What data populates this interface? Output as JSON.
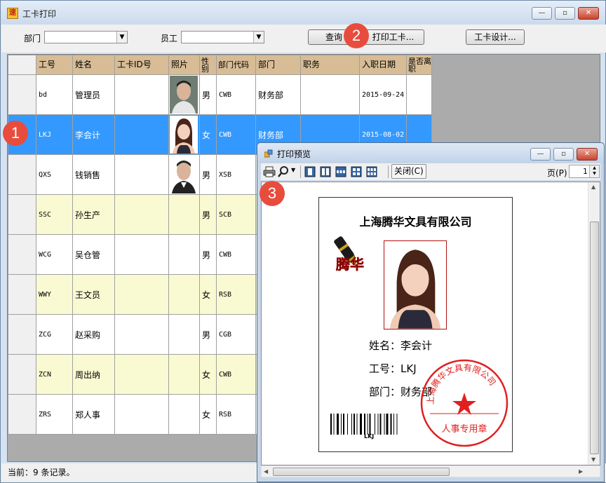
{
  "window": {
    "title": "工卡打印",
    "min_glyph": "—",
    "max_glyph": "▫",
    "close_glyph": "✕"
  },
  "toolbar": {
    "dept_label": "部门",
    "dept_value": "",
    "staff_label": "员工",
    "staff_value": "",
    "query_button": "查询",
    "print_button": "打印工卡...",
    "design_button": "工卡设计..."
  },
  "grid": {
    "columns": [
      "工号",
      "姓名",
      "工卡ID号",
      "照片",
      "性别",
      "部门代码",
      "部门",
      "职务",
      "入职日期",
      "是否离职"
    ],
    "rows": [
      {
        "id": "bd",
        "name": "管理员",
        "card_id": "",
        "photo": "male-1",
        "gender": "男",
        "dept_code": "CWB",
        "dept": "财务部",
        "title": "",
        "hire_date": "2015-09-24",
        "left": ""
      },
      {
        "id": "LKJ",
        "name": "李会计",
        "card_id": "",
        "photo": "female-1",
        "gender": "女",
        "dept_code": "CWB",
        "dept": "财务部",
        "title": "",
        "hire_date": "2015-08-02",
        "left": ""
      },
      {
        "id": "QXS",
        "name": "钱销售",
        "card_id": "",
        "photo": "male-2",
        "gender": "男",
        "dept_code": "XSB",
        "dept": "",
        "title": "",
        "hire_date": "",
        "left": ""
      },
      {
        "id": "SSC",
        "name": "孙生产",
        "card_id": "",
        "photo": "",
        "gender": "男",
        "dept_code": "SCB",
        "dept": "",
        "title": "",
        "hire_date": "",
        "left": ""
      },
      {
        "id": "WCG",
        "name": "吴仓管",
        "card_id": "",
        "photo": "",
        "gender": "男",
        "dept_code": "CWB",
        "dept": "",
        "title": "",
        "hire_date": "",
        "left": ""
      },
      {
        "id": "WWY",
        "name": "王文员",
        "card_id": "",
        "photo": "",
        "gender": "女",
        "dept_code": "RSB",
        "dept": "",
        "title": "",
        "hire_date": "",
        "left": ""
      },
      {
        "id": "ZCG",
        "name": "赵采购",
        "card_id": "",
        "photo": "",
        "gender": "男",
        "dept_code": "CGB",
        "dept": "",
        "title": "",
        "hire_date": "",
        "left": ""
      },
      {
        "id": "ZCN",
        "name": "周出纳",
        "card_id": "",
        "photo": "",
        "gender": "女",
        "dept_code": "CWB",
        "dept": "",
        "title": "",
        "hire_date": "",
        "left": ""
      },
      {
        "id": "ZRS",
        "name": "郑人事",
        "card_id": "",
        "photo": "",
        "gender": "女",
        "dept_code": "RSB",
        "dept": "",
        "title": "",
        "hire_date": "",
        "left": ""
      }
    ],
    "selected_index": 1
  },
  "status": "当前：9 条记录。",
  "markers": [
    "1",
    "2",
    "3"
  ],
  "preview": {
    "title": "打印预览",
    "close_button": "关闭(C)",
    "page_label": "页(P)",
    "page_value": "1",
    "card": {
      "company": "上海腾华文具有限公司",
      "logo_text": "腾华",
      "name_line": "姓名：李会计",
      "id_line": "工号：LKJ",
      "dept_line": "部门：财务部",
      "barcode_text": "LKJ",
      "seal_top_text": "上海腾华文具有限公司",
      "seal_bottom_text": "人事专用章"
    }
  },
  "colors": {
    "header_tan": "#d7bc96",
    "selection_blue": "#3399ff",
    "alt_row_yellow": "#fafad2",
    "marker_red": "#e84c3d",
    "seal_red": "#e02020"
  },
  "icons": [
    "app-icon",
    "printer-icon",
    "zoom-icon",
    "page-single-icon",
    "page-two-icon",
    "page-three-icon",
    "page-four-icon",
    "page-six-icon"
  ]
}
